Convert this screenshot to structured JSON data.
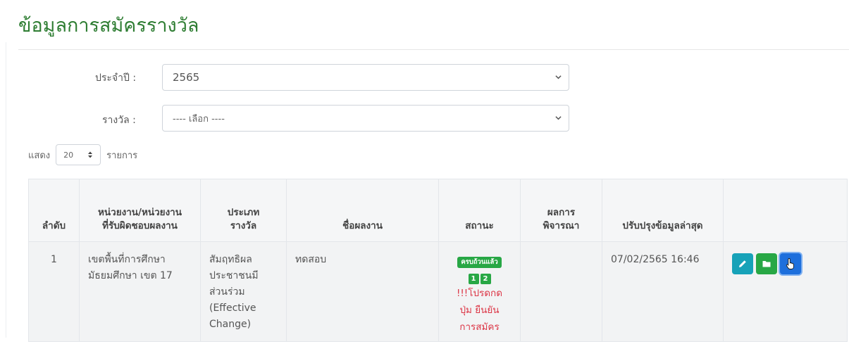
{
  "title": "ข้อมูลการสมัครรางวัล",
  "filters": {
    "year_label": "ประจำปี :",
    "year_value": "2565",
    "award_label": "รางวัล :",
    "award_value": "---- เลือก ----"
  },
  "length": {
    "prefix": "แสดง",
    "value": "20",
    "suffix": "รายการ"
  },
  "table": {
    "headers": {
      "no": "ลำดับ",
      "agency_1": "หน่วยงาน/หน่วยงาน",
      "agency_2": "ที่รับผิดชอบผลงาน",
      "type_1": "ประเภท",
      "type_2": "รางวัล",
      "work_name": "ชื่อผลงาน",
      "status": "สถานะ",
      "result_1": "ผลการ",
      "result_2": "พิจารณา",
      "updated": "ปรับปรุงข้อมูลล่าสุด",
      "actions": ""
    },
    "rows": [
      {
        "no": "1",
        "agency_1": "เขตพื้นที่การศึกษา",
        "agency_2": "มัธยมศึกษา เขต 17",
        "type_1": "สัมฤทธิผล",
        "type_2": "ประชาชนมี",
        "type_3": "ส่วนร่วม",
        "type_4": "(Effective",
        "type_5": "Change)",
        "work_name": "ทดสอบ",
        "status_badge": "ครบถ้วนแล้ว",
        "steps": [
          "1",
          "2"
        ],
        "status_note_1": "!!!โปรดกด",
        "status_note_2": "ปุ่ม ยืนยัน",
        "status_note_3": "การสมัคร",
        "result": "",
        "updated": "07/02/2565 16:46"
      }
    ]
  },
  "colors": {
    "title": "#2e7d32",
    "edit": "#17a2b8",
    "file": "#28a745",
    "submit": "#1e6fdc",
    "warn": "#dc3545"
  },
  "icons": {
    "edit": "pencil-icon",
    "file": "folder-icon",
    "submit": "hand-pointer-icon"
  }
}
